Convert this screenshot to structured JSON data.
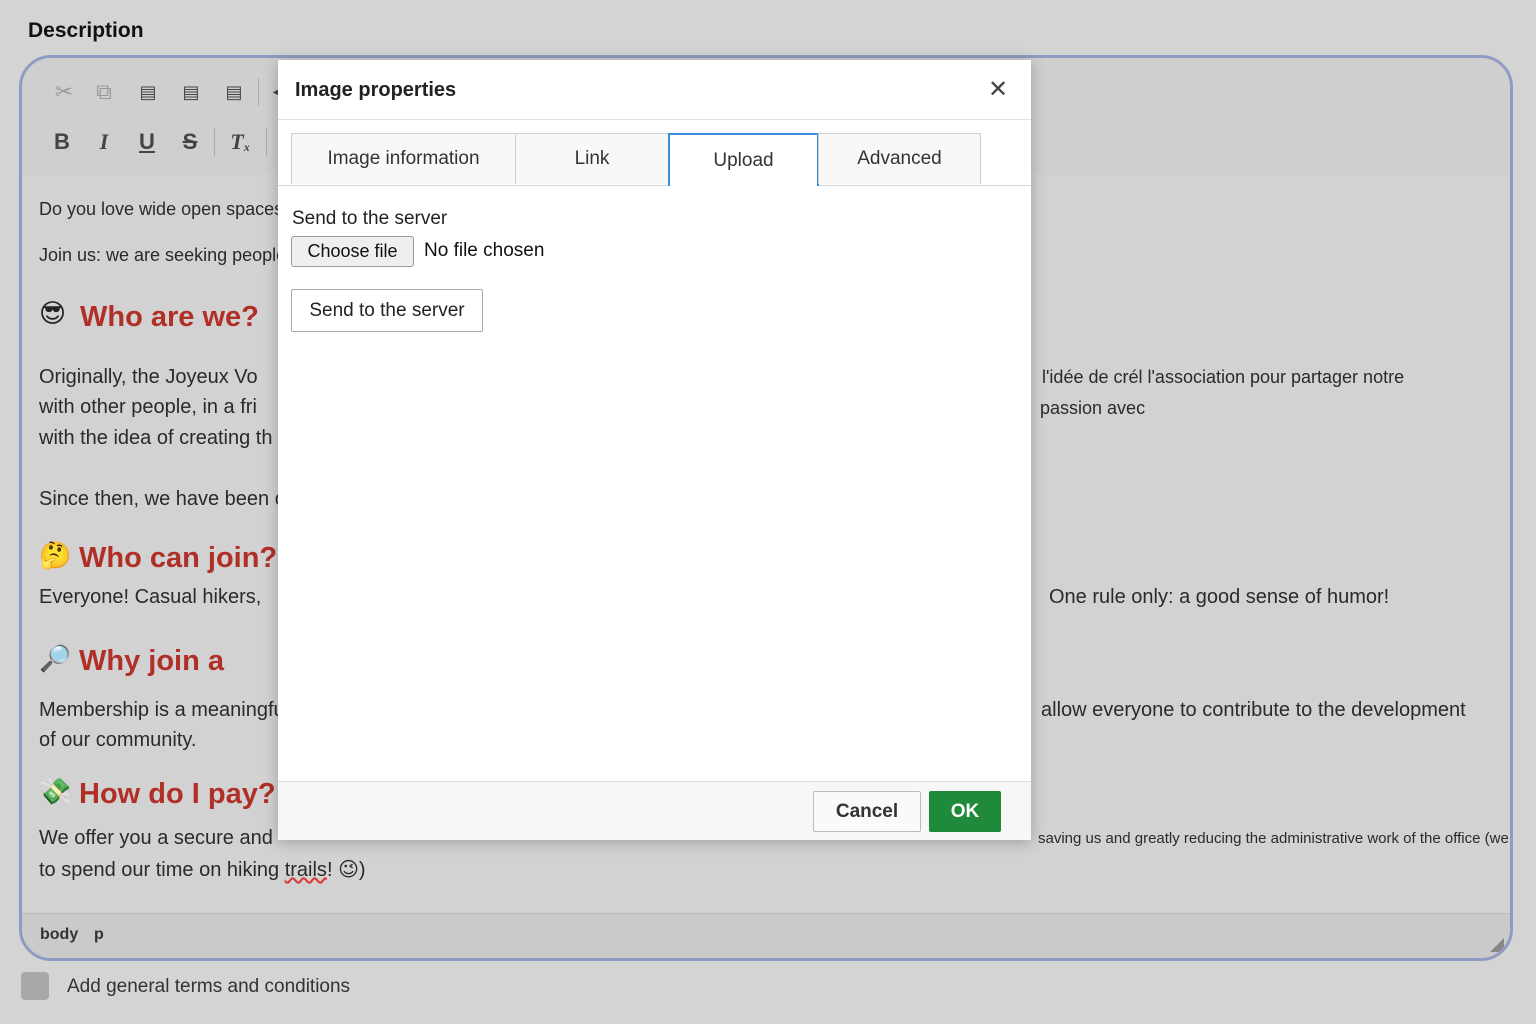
{
  "field_label": "Description",
  "toolbar": {
    "row1": [
      {
        "name": "cut-icon",
        "glyph": "✂",
        "enabled": false
      },
      {
        "name": "copy-icon",
        "glyph": "⧉",
        "enabled": false
      },
      {
        "name": "paste-icon",
        "glyph": "📋",
        "enabled": true
      },
      {
        "name": "paste-text-icon",
        "glyph": "📋",
        "enabled": true
      },
      {
        "name": "paste-word-icon",
        "glyph": "📋",
        "enabled": true
      }
    ],
    "row2": [
      {
        "name": "bold-icon",
        "glyph": "B"
      },
      {
        "name": "italic-icon",
        "glyph": "I"
      },
      {
        "name": "underline-icon",
        "glyph": "U"
      },
      {
        "name": "strike-icon",
        "glyph": "S"
      },
      {
        "name": "remove-format-icon",
        "glyph": "Tx"
      }
    ]
  },
  "content": {
    "intro1": "Do you love wide open spaces",
    "intro2": "Join us: we are seeking people",
    "h_who": "Who are we?",
    "h_who_emoji": "😎",
    "who_p1a": "Originally, the Joyeux Vo",
    "who_p1b": "with other people, in a fri",
    "who_p1c": "with the idea of creating th",
    "who_r1": "l'idée de crél l'association pour partager notre",
    "who_r2": "passion avec",
    "since": "Since then, we have been c",
    "h_join": "Who can join?",
    "h_join_emoji": "🤔",
    "join_p": "Everyone! Casual hikers,",
    "join_r": "One rule only: a good sense of humor!",
    "h_why": "Why join a",
    "h_why_emoji": "🔎",
    "why_p1": "Membership is a meaningfu",
    "why_r1": "allow everyone to contribute to the development",
    "why_p2": "of our community.",
    "h_pay": "How do I pay?",
    "h_pay_emoji": "💸",
    "pay_p1": "We offer you a secure and",
    "pay_r1": "saving us and greatly reducing the administrative work of the office (we prefer",
    "pay_p2_a": "to spend our time on hiking ",
    "pay_p2_b": "trails",
    "pay_p2_c": "! ",
    "pay_p2_emoji": "😉",
    "pay_p2_d": ")"
  },
  "statusbar": {
    "path1": "body",
    "path2": "p"
  },
  "terms_label": "Add general terms and conditions",
  "dialog": {
    "title": "Image properties",
    "close_glyph": "✕",
    "tabs": [
      "Image information",
      "Link",
      "Upload",
      "Advanced"
    ],
    "active_tab": "Upload",
    "send_label": "Send to the server",
    "choose_file": "Choose file",
    "no_file": "No file chosen",
    "send_button": "Send to the server",
    "cancel": "Cancel",
    "ok": "OK"
  },
  "colors": {
    "accent": "#3b8fd9",
    "ok": "#1e8a3a",
    "heading": "#b03028"
  }
}
